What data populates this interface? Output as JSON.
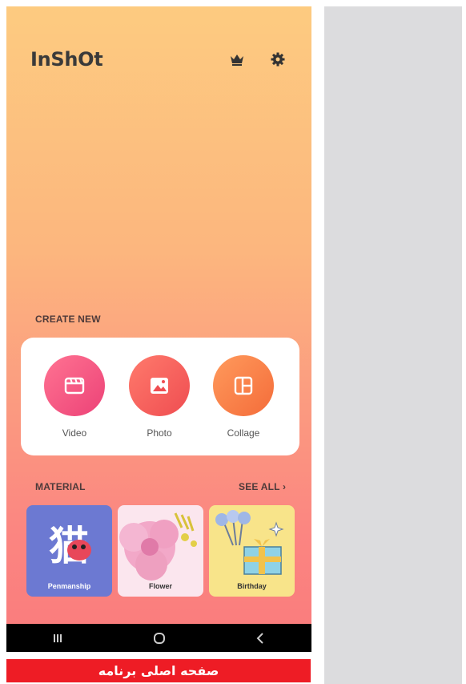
{
  "app": {
    "logo_text": "InShOt",
    "top_icons": [
      "crown-icon",
      "gear-icon"
    ]
  },
  "create_new": {
    "heading": "CREATE NEW",
    "buttons": [
      {
        "label": "Video",
        "icon": "clapperboard-icon",
        "color": "#ec4277"
      },
      {
        "label": "Photo",
        "icon": "image-icon",
        "color": "#ef4d51"
      },
      {
        "label": "Collage",
        "icon": "collage-icon",
        "color": "#f46c3a"
      }
    ]
  },
  "material": {
    "heading": "MATERIAL",
    "see_all": "SEE ALL ›",
    "items": [
      {
        "label": "Penmanship",
        "thumb_text": "猫"
      },
      {
        "label": "Flower"
      },
      {
        "label": "Birthday"
      }
    ]
  },
  "navbar": {
    "icons": [
      "recent-apps-icon",
      "home-icon",
      "back-icon"
    ]
  },
  "caption": "صفحه اصلی برنامه",
  "colors": {
    "gradient_top": "#fdcb80",
    "gradient_bottom": "#fa7b7c",
    "caption_bar": "#ee1c25",
    "side_panel": "#dcdcde"
  }
}
